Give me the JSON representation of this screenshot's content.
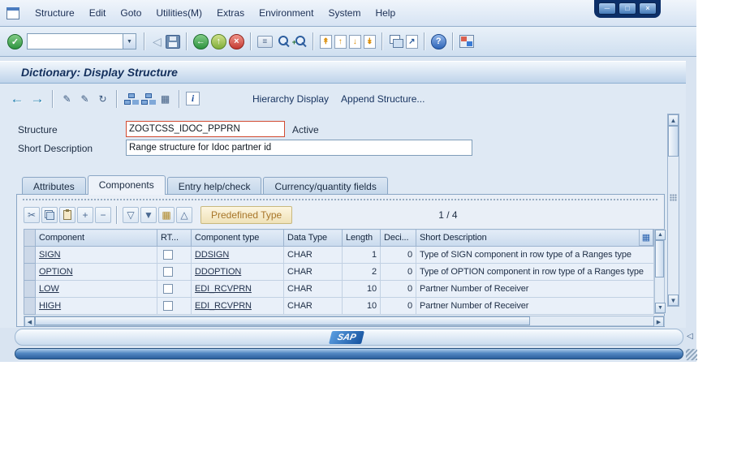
{
  "window": {
    "menu_items": [
      "Structure",
      "Edit",
      "Goto",
      "Utilities(M)",
      "Extras",
      "Environment",
      "System",
      "Help"
    ],
    "controls": {
      "minimize": "─",
      "maximize": "□",
      "close": "×"
    }
  },
  "title": "Dictionary: Display Structure",
  "app_toolbar": {
    "hierarchy_display_label": "Hierarchy Display",
    "append_structure_label": "Append Structure..."
  },
  "form": {
    "structure_label": "Structure",
    "structure_value": "ZOGTCSS_IDOC_PPPRN",
    "status_label": "Active",
    "short_description_label": "Short Description",
    "short_description_value": "Range structure for Idoc partner id"
  },
  "tabs": [
    "Attributes",
    "Components",
    "Entry help/check",
    "Currency/quantity fields"
  ],
  "active_tab": "Components",
  "components_panel": {
    "predefined_type_label": "Predefined Type",
    "position_indicator": "1 / 4"
  },
  "table": {
    "headers": [
      "Component",
      "RT...",
      "Component type",
      "Data Type",
      "Length",
      "Deci...",
      "Short Description"
    ],
    "rows": [
      {
        "component": "SIGN",
        "component_type": "DDSIGN",
        "data_type": "CHAR",
        "length": "1",
        "decimals": "0",
        "description": "Type of SIGN component in row type of a Ranges type"
      },
      {
        "component": "OPTION",
        "component_type": "DDOPTION",
        "data_type": "CHAR",
        "length": "2",
        "decimals": "0",
        "description": "Type of OPTION component in row type of a Ranges type"
      },
      {
        "component": "LOW",
        "component_type": "EDI_RCVPRN",
        "data_type": "CHAR",
        "length": "10",
        "decimals": "0",
        "description": "Partner Number of Receiver"
      },
      {
        "component": "HIGH",
        "component_type": "EDI_RCVPRN",
        "data_type": "CHAR",
        "length": "10",
        "decimals": "0",
        "description": "Partner Number of Receiver"
      }
    ]
  },
  "statusbar": {
    "logo": "SAP",
    "expand_arrow": "◁"
  },
  "icons": {
    "enter": "✓",
    "dropdown": "▼",
    "back_outline": "◁",
    "back": "←",
    "exit": "↑",
    "cancel": "×",
    "print": "≡",
    "find_plus": "+",
    "first_page": "↟",
    "prev_page": "↑",
    "next_page": "↓",
    "last_page": "↡",
    "shortcut": "↗",
    "help": "?",
    "app_back": "←",
    "app_forward": "→",
    "pencil": "✎",
    "refresh": "↻",
    "grid": "▦",
    "info": "i",
    "cut": "✂",
    "insert_row": "+",
    "delete_row": "−",
    "filter_down": "▽",
    "filter_solid": "▼",
    "grid_small": "▦",
    "sort_up": "△",
    "header_config": "▦",
    "scroll_up": "▲",
    "scroll_down": "▼",
    "scroll_left": "◀",
    "scroll_right": "▶"
  }
}
